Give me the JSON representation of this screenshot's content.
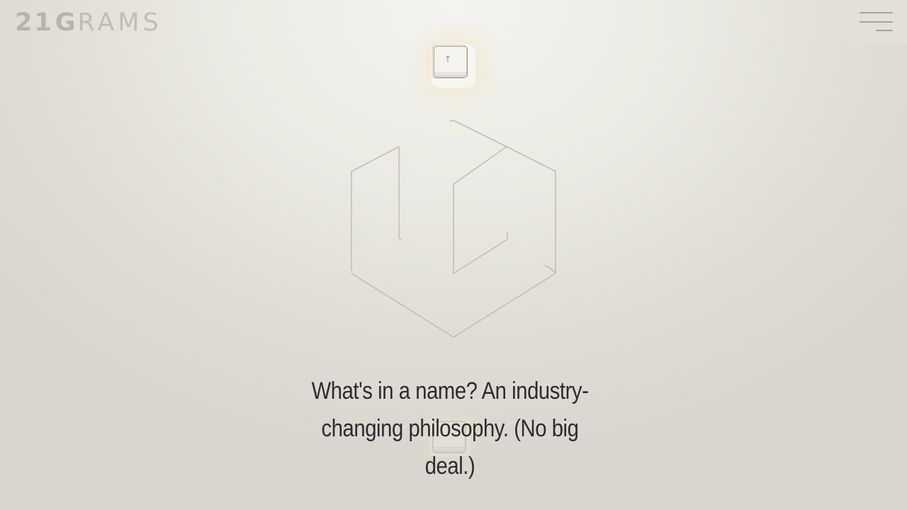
{
  "brand": {
    "logo_number": "21",
    "logo_g": "G",
    "logo_rest": "RAMS",
    "color_primary": "#b9b3a8"
  },
  "header": {
    "menu_icon": "hamburger-icon"
  },
  "scroll_key": {
    "icon": "arrow-up-key-icon",
    "glyph": "↑"
  },
  "hero": {
    "graphic": "cube-outline-icon",
    "tagline": "What's in a name? An industry-changing philosophy. (No big deal.)"
  },
  "colors": {
    "text": "#2d2c2a",
    "line": "#bcb6ab",
    "background": "#e6e4dc"
  }
}
